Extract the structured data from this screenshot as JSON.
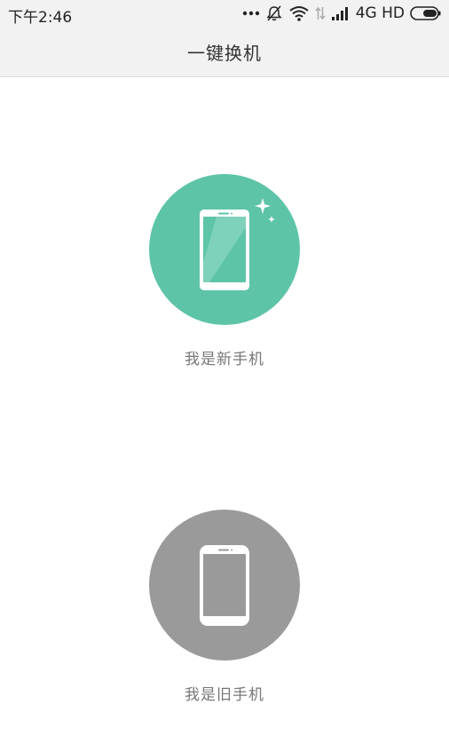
{
  "status_bar": {
    "time": "下午2:46",
    "network": "4G HD",
    "icons": [
      "more-dots-icon",
      "alarm-off-icon",
      "wifi-icon",
      "data-transfer-icon",
      "signal-icon",
      "battery-icon"
    ]
  },
  "header": {
    "title": "一键换机"
  },
  "options": {
    "new_phone": {
      "label": "我是新手机",
      "icon": "new-phone-icon",
      "color": "#5dc4a8"
    },
    "old_phone": {
      "label": "我是旧手机",
      "icon": "old-phone-icon",
      "color": "#9a9a9a"
    }
  },
  "colors": {
    "header_bg": "#f2f2f2",
    "page_bg": "#ffffff"
  }
}
